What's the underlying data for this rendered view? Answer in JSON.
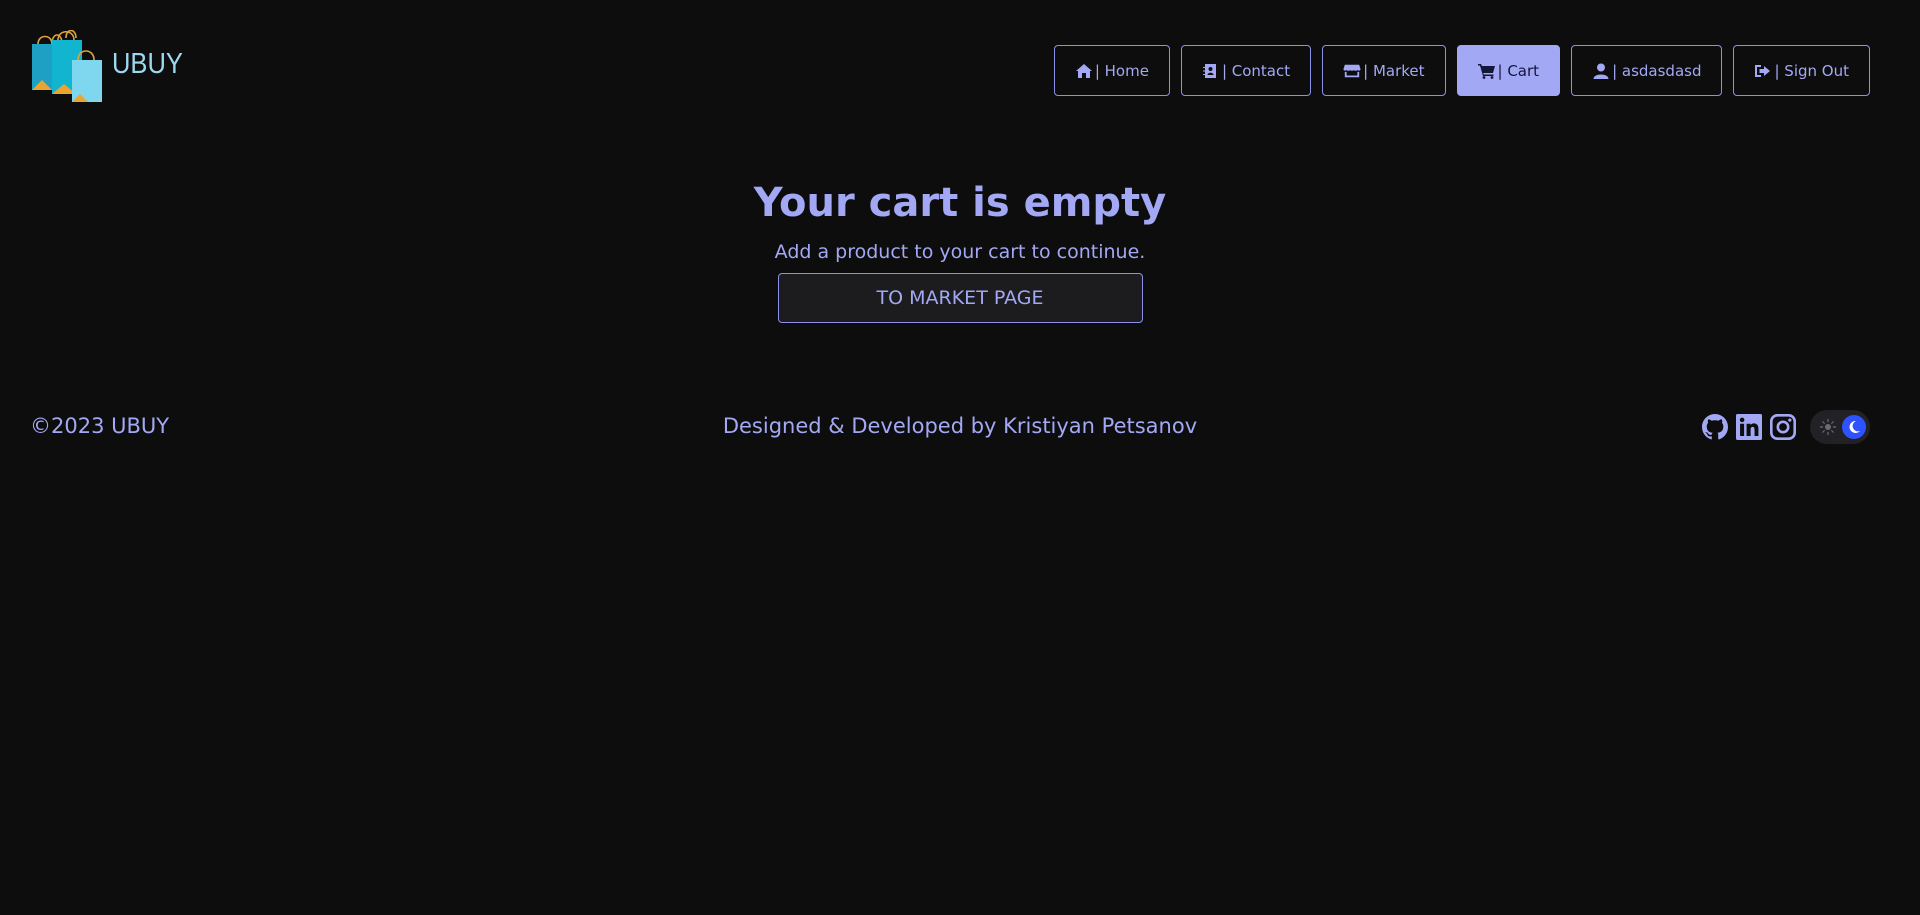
{
  "brand": {
    "name": "UBUY"
  },
  "nav": {
    "items": [
      {
        "label": "| Home",
        "icon": "home-icon"
      },
      {
        "label": "| Contact",
        "icon": "contact-book-icon"
      },
      {
        "label": "| Market",
        "icon": "store-icon"
      },
      {
        "label": "| Cart",
        "icon": "cart-icon",
        "active": true
      },
      {
        "label": "| asdasdasd",
        "icon": "user-icon"
      },
      {
        "label": "| Sign Out",
        "icon": "sign-out-icon"
      }
    ]
  },
  "main": {
    "title": "Your cart is empty",
    "subtitle": "Add a product to your cart to continue.",
    "button_label": "TO MARKET PAGE"
  },
  "footer": {
    "copyright": "©2023 UBUY",
    "credit": "Designed & Developed by Kristiyan Petsanov",
    "social_icons": [
      "github-icon",
      "linkedin-icon",
      "instagram-icon"
    ],
    "theme_toggle": {
      "mode": "dark"
    }
  },
  "colors": {
    "background": "#0d0d0d",
    "accent": "#a3a8f5",
    "toggle_knob": "#2f52ff"
  }
}
